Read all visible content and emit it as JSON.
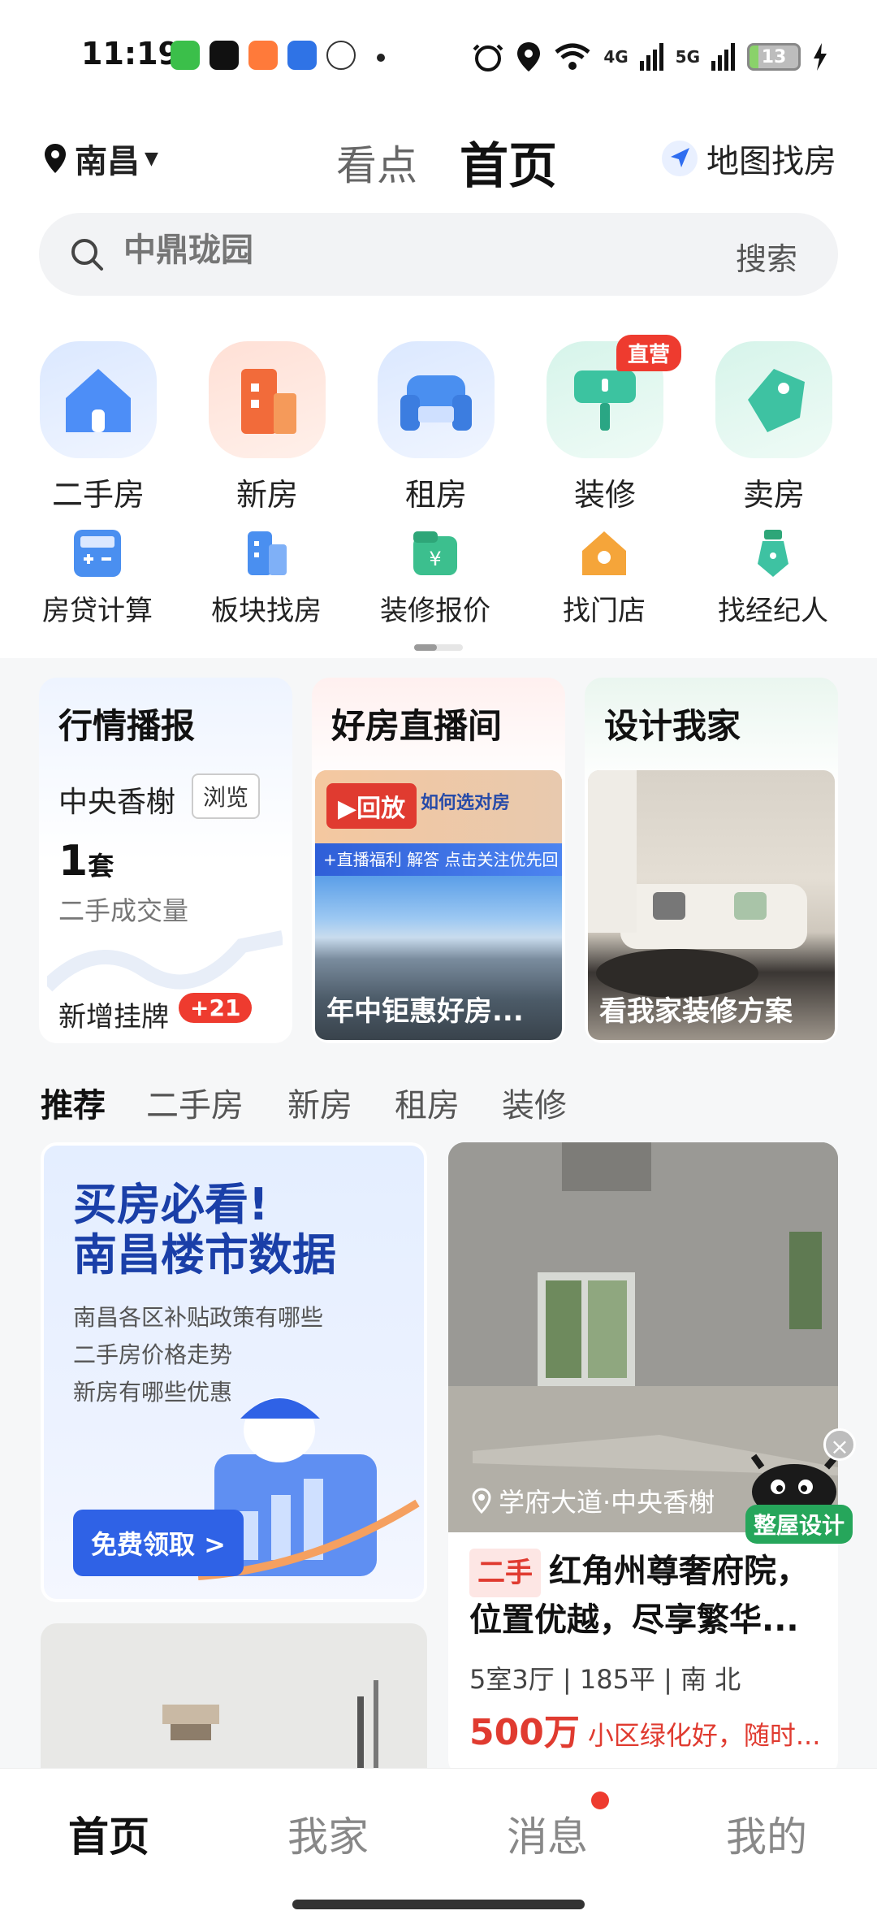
{
  "status_bar": {
    "time": "11:19",
    "network_4g": "4G",
    "network_5g": "5G",
    "battery": "13"
  },
  "header": {
    "city": "南昌",
    "tab_kandian": "看点",
    "tab_home": "首页",
    "map_find": "地图找房"
  },
  "search": {
    "placeholder": "中鼎珑园",
    "button": "搜索"
  },
  "main_icons": [
    {
      "label": "二手房",
      "color": "#4d8ef7"
    },
    {
      "label": "新房",
      "color": "#f26b3a"
    },
    {
      "label": "租房",
      "color": "#4a8ff0"
    },
    {
      "label": "装修",
      "color": "#3cc3a0",
      "badge": "直营"
    },
    {
      "label": "卖房",
      "color": "#3ec2a2"
    }
  ],
  "sub_icons": [
    {
      "label": "房贷计算"
    },
    {
      "label": "板块找房"
    },
    {
      "label": "装修报价"
    },
    {
      "label": "找门店"
    },
    {
      "label": "找经纪人"
    }
  ],
  "features": {
    "market": {
      "title": "行情播报",
      "community": "中央香榭",
      "browse": "浏览",
      "count": "1",
      "unit": "套",
      "sub": "二手成交量",
      "new_listing": "新增挂牌",
      "new_badge": "+21"
    },
    "live": {
      "title": "好房直播间",
      "replay": "▶回放",
      "caption": "年中钜惠好房...",
      "banner_top": "如何选对房",
      "banner_strip": "+直播福利  解答  点击关注优先回"
    },
    "design": {
      "title": "设计我家",
      "caption": "看我家装修方案"
    }
  },
  "category_tabs": [
    "推荐",
    "二手房",
    "新房",
    "租房",
    "装修"
  ],
  "promo": {
    "title_line1": "买房必看!",
    "title_line2": "南昌楼市数据",
    "lines": [
      "南昌各区补贴政策有哪些",
      "二手房价格走势",
      "新房有哪些优惠"
    ],
    "button": "免费领取 >"
  },
  "listing": {
    "location": "学府大道·中央香榭",
    "tag": "二手",
    "title": "红角州尊奢府院，位置优越，尽享繁华...",
    "spec": "5室3厅 | 185平 | 南 北",
    "price": "500万",
    "note": "小区绿化好，随时..."
  },
  "float_ad": {
    "label": "整屋设计",
    "close": "×"
  },
  "bottom_nav": [
    "首页",
    "我家",
    "消息",
    "我的"
  ]
}
